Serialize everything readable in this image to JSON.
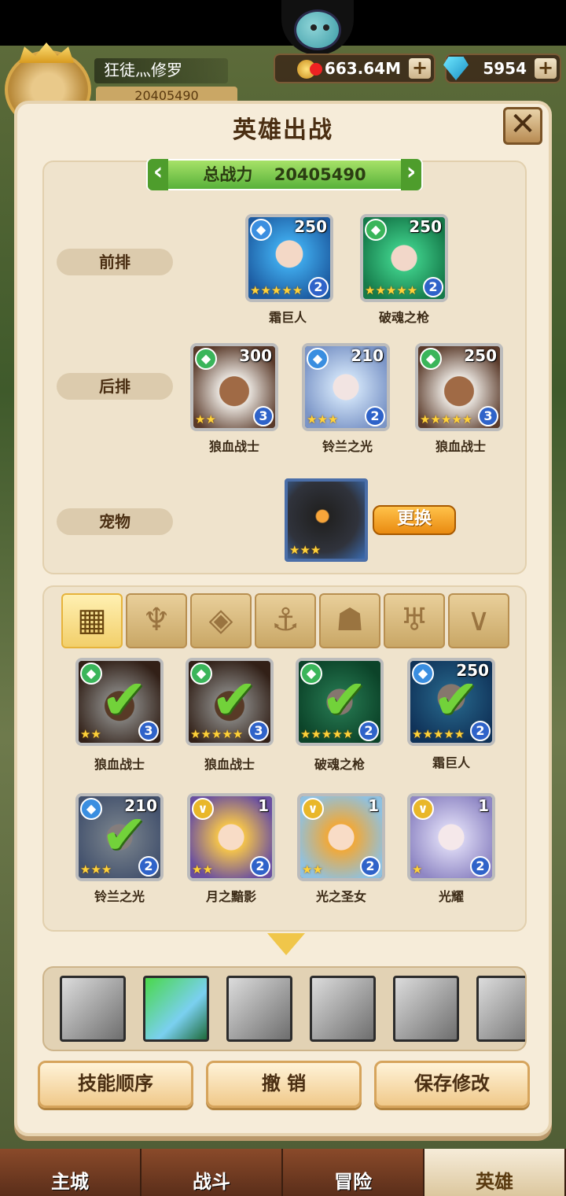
{
  "header": {
    "player_name": "狂徒灬修罗",
    "player_power": "20405490",
    "gold": "663.64M",
    "gems": "5954"
  },
  "dialog": {
    "title": "英雄出战",
    "total_power_label": "总战力",
    "total_power_value": "20405490"
  },
  "rows": {
    "front": "前排",
    "back": "后排",
    "pet": "宠物"
  },
  "front_heroes": [
    {
      "name": "霜巨人",
      "level": "250",
      "rank": "2",
      "stars": "★★★★★"
    },
    {
      "name": "破魂之枪",
      "level": "250",
      "rank": "2",
      "stars": "★★★★★"
    }
  ],
  "back_heroes": [
    {
      "name": "狼血战士",
      "level": "300",
      "rank": "3",
      "stars": "★★"
    },
    {
      "name": "铃兰之光",
      "level": "210",
      "rank": "2",
      "stars": "★★★"
    },
    {
      "name": "狼血战士",
      "level": "250",
      "rank": "3",
      "stars": "★★★★★"
    }
  ],
  "pet": {
    "stars": "★★★",
    "swap_label": "更换"
  },
  "filter_tabs": [
    "all",
    "type-1",
    "type-2",
    "type-3",
    "type-4",
    "type-5",
    "type-6"
  ],
  "roster": [
    {
      "name": "狼血战士",
      "level": "",
      "rank": "3",
      "stars": "★★",
      "selected": true
    },
    {
      "name": "狼血战士",
      "level": "",
      "rank": "3",
      "stars": "★★★★★",
      "selected": true
    },
    {
      "name": "破魂之枪",
      "level": "",
      "rank": "2",
      "stars": "★★★★★",
      "selected": true
    },
    {
      "name": "霜巨人",
      "level": "250",
      "rank": "2",
      "stars": "★★★★★",
      "selected": true
    },
    {
      "name": "铃兰之光",
      "level": "210",
      "rank": "2",
      "stars": "★★★",
      "selected": true
    },
    {
      "name": "月之黯影",
      "level": "1",
      "rank": "2",
      "stars": "★★",
      "selected": false
    },
    {
      "name": "光之圣女",
      "level": "1",
      "rank": "2",
      "stars": "★★",
      "selected": false
    },
    {
      "name": "光耀",
      "level": "1",
      "rank": "2",
      "stars": "★",
      "selected": false
    }
  ],
  "buttons": {
    "skill_order": "技能顺序",
    "undo": "撤 销",
    "save": "保存修改"
  },
  "nav": {
    "city": "主城",
    "battle": "战斗",
    "adventure": "冒险",
    "hero": "英雄"
  }
}
